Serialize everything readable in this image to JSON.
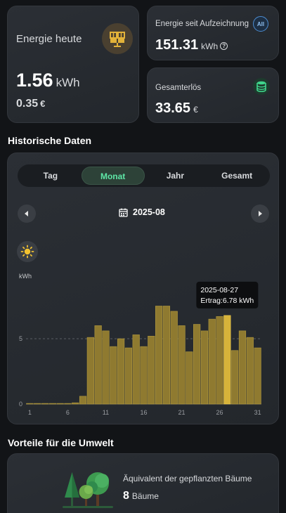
{
  "today": {
    "title": "Energie heute",
    "energy_value": "1.56",
    "energy_unit": "kWh",
    "money_value": "0.35",
    "money_unit": "€",
    "icon": "solar-panel-icon"
  },
  "total_energy": {
    "label": "Energie seit Aufzeichnung",
    "badge": "All",
    "value": "151.31",
    "unit": "kWh",
    "help_glyph": "?"
  },
  "revenue": {
    "label": "Gesamterlös",
    "value": "33.65",
    "unit": "€",
    "icon": "database-icon"
  },
  "history": {
    "title": "Historische Daten",
    "tabs": [
      {
        "label": "Tag",
        "active": false
      },
      {
        "label": "Monat",
        "active": true
      },
      {
        "label": "Jahr",
        "active": false
      },
      {
        "label": "Gesamt",
        "active": false
      }
    ],
    "date": "2025-08",
    "tooltip": {
      "date": "2025-08-27",
      "text": "Ertrag:6.78 kWh"
    }
  },
  "chart_data": {
    "type": "bar",
    "ylabel": "kWh",
    "ylim": [
      0,
      10
    ],
    "yticks": [
      0,
      5
    ],
    "categories": [
      1,
      2,
      3,
      4,
      5,
      6,
      7,
      8,
      9,
      10,
      11,
      12,
      13,
      14,
      15,
      16,
      17,
      18,
      19,
      20,
      21,
      22,
      23,
      24,
      25,
      26,
      27,
      28,
      29,
      30,
      31
    ],
    "xtick_labels": [
      "1",
      "6",
      "11",
      "16",
      "21",
      "26",
      "31"
    ],
    "values": [
      0.05,
      0.05,
      0.05,
      0.05,
      0.05,
      0.05,
      0.1,
      0.6,
      5.1,
      6.0,
      5.6,
      4.4,
      5.0,
      4.3,
      5.3,
      4.4,
      5.2,
      7.5,
      7.5,
      7.1,
      6.0,
      4.0,
      6.1,
      5.6,
      6.5,
      6.7,
      6.78,
      4.1,
      5.6,
      5.1,
      4.3
    ],
    "highlight_index": 26,
    "bar_color": "#8f7a30",
    "highlight_color": "#d7b33a",
    "grid_dashed_at": 5
  },
  "environment": {
    "title": "Vorteile für die Umwelt",
    "label": "Äquivalent der gepflanzten Bäume",
    "count": "8",
    "unit": "Bäume",
    "icon": "trees-icon"
  }
}
